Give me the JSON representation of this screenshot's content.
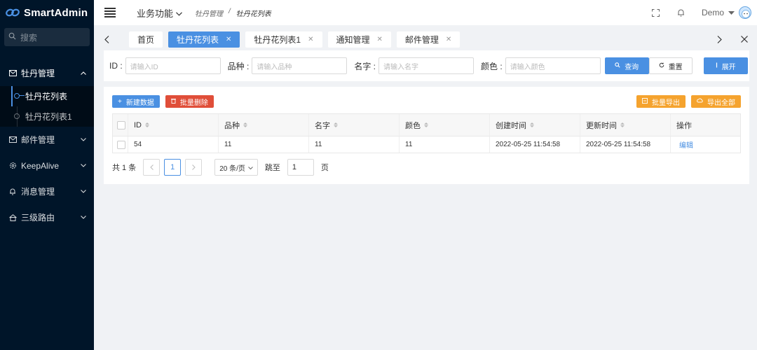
{
  "app": {
    "name": "SmartAdmin"
  },
  "sidebar": {
    "search_placeholder": "搜索",
    "menu": [
      {
        "label": "牡丹管理",
        "icon": "mail-icon",
        "open": true,
        "children": [
          {
            "label": "牡丹花列表",
            "active": true
          },
          {
            "label": "牡丹花列表1",
            "active": false
          }
        ]
      },
      {
        "label": "邮件管理",
        "icon": "mail-icon"
      },
      {
        "label": "KeepAlive",
        "icon": "gear-icon"
      },
      {
        "label": "消息管理",
        "icon": "bell-icon"
      },
      {
        "label": "三级路由",
        "icon": "home-icon"
      }
    ]
  },
  "header": {
    "module": "业务功能",
    "breadcrumb": [
      "牡丹管理",
      "/",
      "牡丹花列表"
    ],
    "user": "Demo"
  },
  "tabs": [
    {
      "label": "首页",
      "closable": false
    },
    {
      "label": "牡丹花列表",
      "closable": true,
      "active": true
    },
    {
      "label": "牡丹花列表1",
      "closable": true
    },
    {
      "label": "通知管理",
      "closable": true
    },
    {
      "label": "邮件管理",
      "closable": true
    }
  ],
  "query": {
    "fields": [
      {
        "label": "ID :",
        "placeholder": "请输入ID"
      },
      {
        "label": "品种 :",
        "placeholder": "请输入品种"
      },
      {
        "label": "名字 :",
        "placeholder": "请输入名字"
      },
      {
        "label": "颜色 :",
        "placeholder": "请输入颜色"
      }
    ],
    "search_label": "查询",
    "reset_label": "重置",
    "expand_label": "展开"
  },
  "toolbar": {
    "create_label": "新建数据",
    "batch_delete_label": "批量删除",
    "batch_export_label": "批量导出",
    "export_all_label": "导出全部"
  },
  "table": {
    "columns": [
      "ID",
      "品种",
      "名字",
      "颜色",
      "创建时间",
      "更新时间",
      "操作"
    ],
    "rows": [
      {
        "id": "54",
        "variety": "11",
        "name": "11",
        "color": "11",
        "created": "2022-05-25 11:54:58",
        "updated": "2022-05-25 11:54:58",
        "action": "编辑"
      }
    ]
  },
  "pagination": {
    "total_text": "共 1 条",
    "current_page": "1",
    "page_size": "20 条/页",
    "jump_label": "跳至",
    "jump_value": "1",
    "page_suffix": "页"
  },
  "colors": {
    "primary": "#4a90e2",
    "danger": "#e04e39",
    "warning": "#f5a32e",
    "sidebar_bg": "#001529"
  }
}
